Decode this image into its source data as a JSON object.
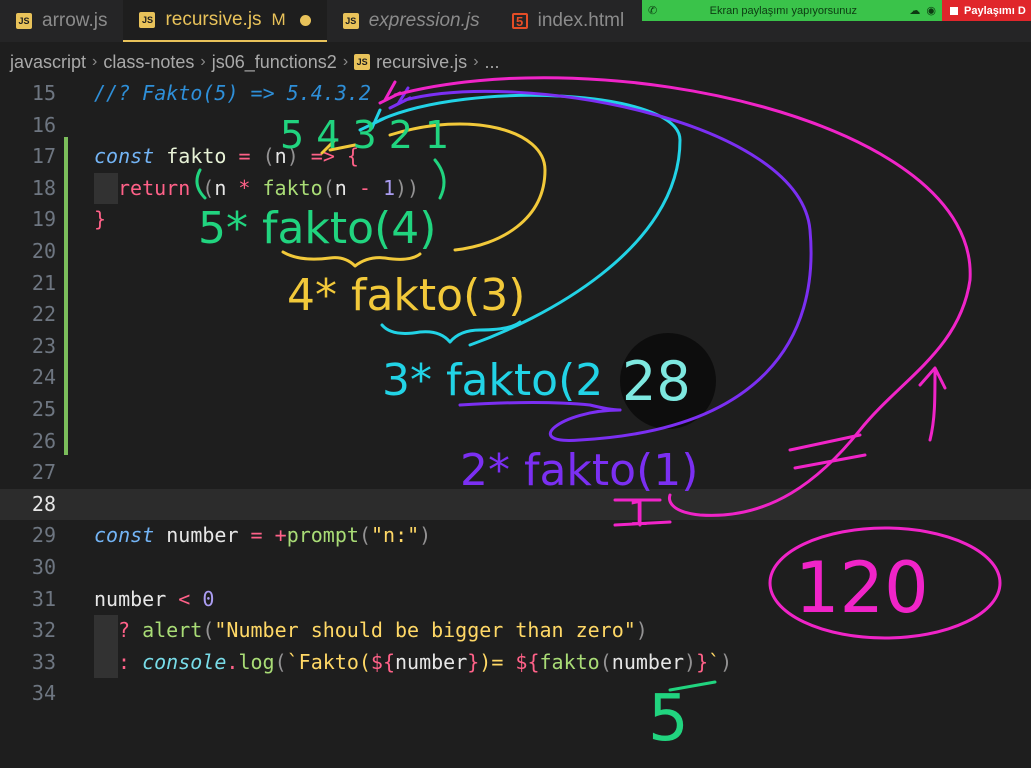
{
  "tabs": [
    {
      "label": "arrow.js",
      "icon": "js-icon",
      "active": false
    },
    {
      "label": "recursive.js",
      "icon": "js-icon",
      "active": true,
      "status": "M"
    },
    {
      "label": "expression.js",
      "icon": "js-icon",
      "active": false
    },
    {
      "label": "index.html",
      "icon": "html-icon",
      "active": false
    }
  ],
  "share": {
    "status_text": "Ekran paylaşımı yapıyorsunuz",
    "stop_text": "Paylaşımı D"
  },
  "breadcrumb": [
    "javascript",
    "class-notes",
    "js06_functions2",
    "recursive.js",
    "..."
  ],
  "editor": {
    "current_line": "28",
    "line_numbers": [
      "15",
      "16",
      "17",
      "18",
      "19",
      "20",
      "21",
      "22",
      "23",
      "24",
      "25",
      "26",
      "27",
      "28",
      "29",
      "30",
      "31",
      "32",
      "33",
      "34"
    ],
    "lines": {
      "l15": "//? Fakto(5) => 5.4.3.2",
      "l17": {
        "kw": "const",
        "name": " fakto",
        "eq": " = ",
        "open": "(",
        "param": "n",
        "close": ")",
        "arrow": " => ",
        "brace": "{"
      },
      "l18": {
        "ret": "return",
        "p1": " (",
        "n": "n",
        "mul": " * ",
        "call": "fakto",
        "p2": "(",
        "n2": "n",
        "minus": " - ",
        "one": "1",
        "p3": ")",
        "p4": ")"
      },
      "l19": "}",
      "l29": {
        "kw": "const",
        "name": " number",
        "eq": " = ",
        "plus": "+",
        "call": "prompt",
        "p1": "(",
        "str": "\"n:\"",
        "p2": ")"
      },
      "l31": {
        "name": "number",
        "lt": " < ",
        "zero": "0"
      },
      "l32": {
        "q": "? ",
        "call": "alert",
        "p1": "(",
        "str": "\"Number should be bigger than zero\"",
        "p2": ")"
      },
      "l33": {
        "colon": ": ",
        "obj": "console",
        "dot": ".",
        "call": "log",
        "p1": "(",
        "tpl1": "`Fakto(",
        "d1": "${",
        "v1": "number",
        "c1": "}",
        "tpl2": ")= ",
        "d2": "${",
        "fn": "fakto",
        "p3": "(",
        "v2": "number",
        "p4": ")",
        "c2": "}",
        "tpl3": "`",
        "p5": ")"
      }
    }
  },
  "annotations": {
    "top_digits": "5 4 3 2 1",
    "step1": "5* fakto(4)",
    "step2": "4* fakto(3)",
    "step3": "3* fakto(2",
    "step4": "2* fakto(1)",
    "one_result": "1",
    "result": "120",
    "input": "5",
    "cursor_number": "28",
    "colors": {
      "green": "#21d47f",
      "yellow": "#f2c93a",
      "cyan": "#22d3e6",
      "purple": "#7b2ff2",
      "magenta": "#f024c8"
    }
  }
}
